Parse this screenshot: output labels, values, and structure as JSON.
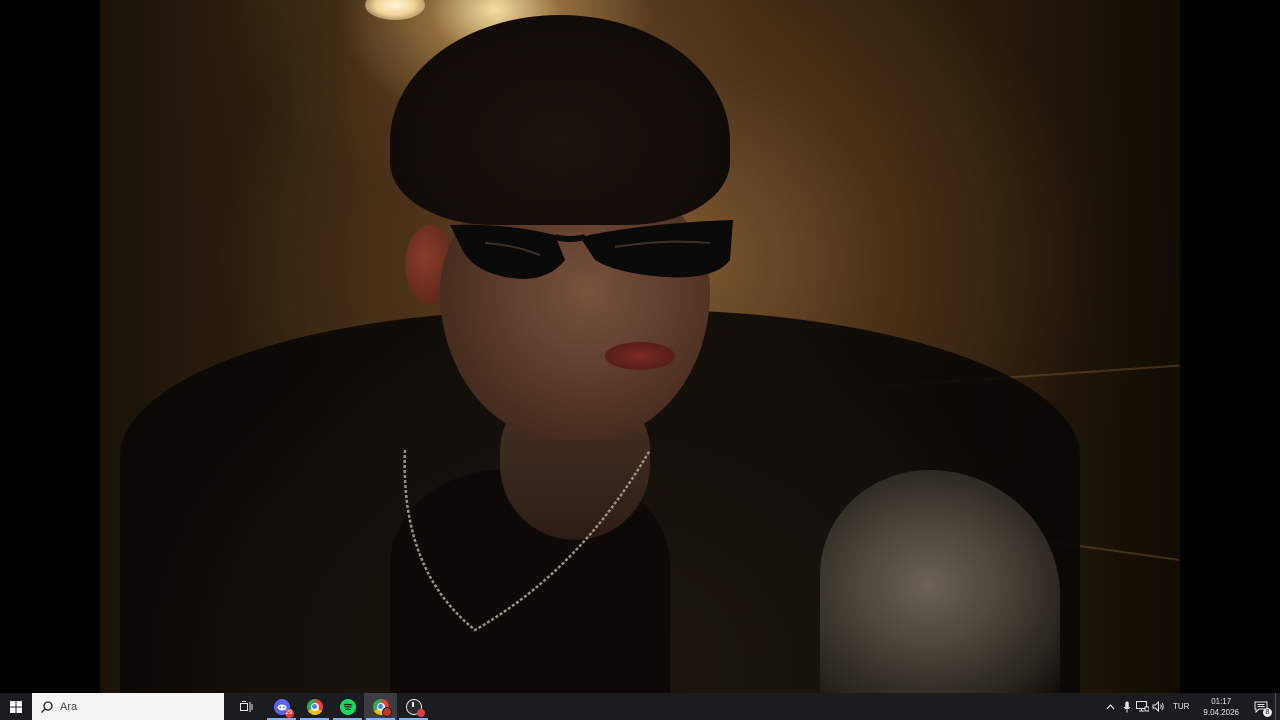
{
  "taskbar": {
    "search": {
      "placeholder": "Ara"
    },
    "apps": [
      {
        "name": "discord",
        "badge": "29"
      },
      {
        "name": "chrome"
      },
      {
        "name": "spotify"
      },
      {
        "name": "chrome-profile"
      },
      {
        "name": "app-with-red-badge"
      }
    ],
    "tray": {
      "language": "TUR",
      "time": "01:17",
      "date": "9.04.2026",
      "notification_count": "8"
    }
  },
  "colors": {
    "taskbar_bg": "#1b1c1f",
    "active_indicator": "#7fb2f0",
    "discord": "#5865f2",
    "spotify": "#1ed760"
  }
}
